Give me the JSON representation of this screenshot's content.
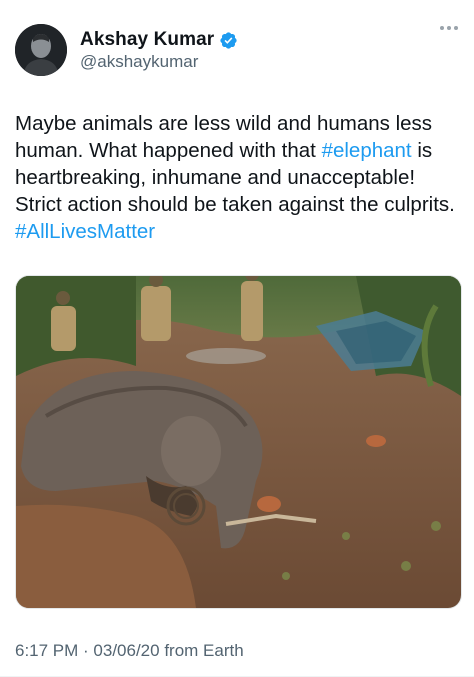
{
  "author": {
    "display_name": "Akshay Kumar",
    "handle": "@akshaykumar",
    "verified": true,
    "verified_color": "#1d9bf0"
  },
  "tweet": {
    "text_parts": [
      "Maybe animals are less wild and humans less human. What happened with that ",
      "#elephant",
      " is heartbreaking, inhumane and unacceptable! Strict action should be taken against the culprits. ",
      "#AllLivesMatter"
    ],
    "hashtag_color": "#1d9bf0"
  },
  "meta": {
    "time": "6:17 PM",
    "separator": " · ",
    "date": "03/06/20",
    "source": " from Earth"
  },
  "icons": {
    "more": "more-horizontal-icon",
    "verified": "verified-badge-icon"
  }
}
